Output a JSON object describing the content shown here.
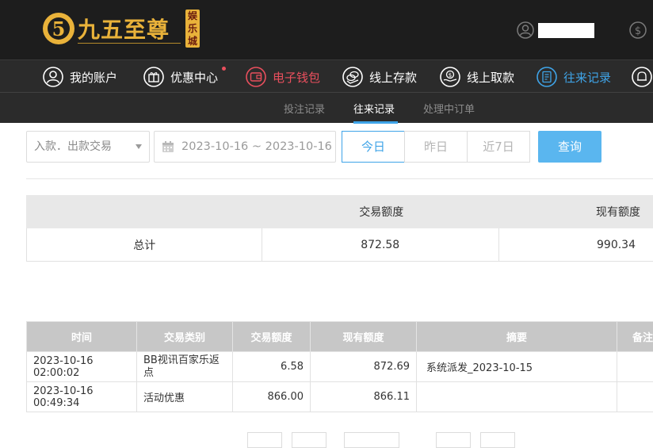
{
  "brand": {
    "name": "九五至尊",
    "badge": "娱乐城",
    "glyph": "5"
  },
  "nav": {
    "items": [
      {
        "label": "我的账户",
        "icon": "user-circle-icon"
      },
      {
        "label": "优惠中心",
        "icon": "gift-icon"
      },
      {
        "label": "电子钱包",
        "icon": "wallet-icon"
      },
      {
        "label": "线上存款",
        "icon": "deposit-icon"
      },
      {
        "label": "线上取款",
        "icon": "withdraw-icon"
      },
      {
        "label": "往来记录",
        "icon": "records-icon"
      }
    ]
  },
  "subnav": {
    "items": [
      "投注记录",
      "往来记录",
      "处理中订单"
    ],
    "active": "往来记录"
  },
  "filters": {
    "type_select": "入款．出款交易",
    "date_range": "2023-10-16 ~ 2023-10-16",
    "quick": [
      "今日",
      "昨日",
      "近7日"
    ],
    "active_quick": "今日",
    "search_label": "查询"
  },
  "summary": {
    "headers": [
      "",
      "交易额度",
      "现有额度"
    ],
    "row": {
      "label": "总计",
      "amount": "872.58",
      "balance": "990.34"
    }
  },
  "records": {
    "headers": [
      "时间",
      "交易类别",
      "交易额度",
      "现有额度",
      "摘要",
      "备注"
    ],
    "rows": [
      {
        "time": "2023-10-16 02:00:02",
        "type": "BB视讯百家乐返点",
        "amount": "6.58",
        "balance": "872.69",
        "summary": "系统派发_2023-10-15",
        "note": ""
      },
      {
        "time": "2023-10-16 00:49:34",
        "type": "活动优惠",
        "amount": "866.00",
        "balance": "866.11",
        "summary": "",
        "note": ""
      }
    ]
  },
  "colors": {
    "header_bg": "#1d1d1d",
    "nav_bg": "#2b2b2b",
    "gold": "#e9b23a",
    "accent_blue": "#3fa4e8",
    "accent_red": "#e94f5d"
  }
}
